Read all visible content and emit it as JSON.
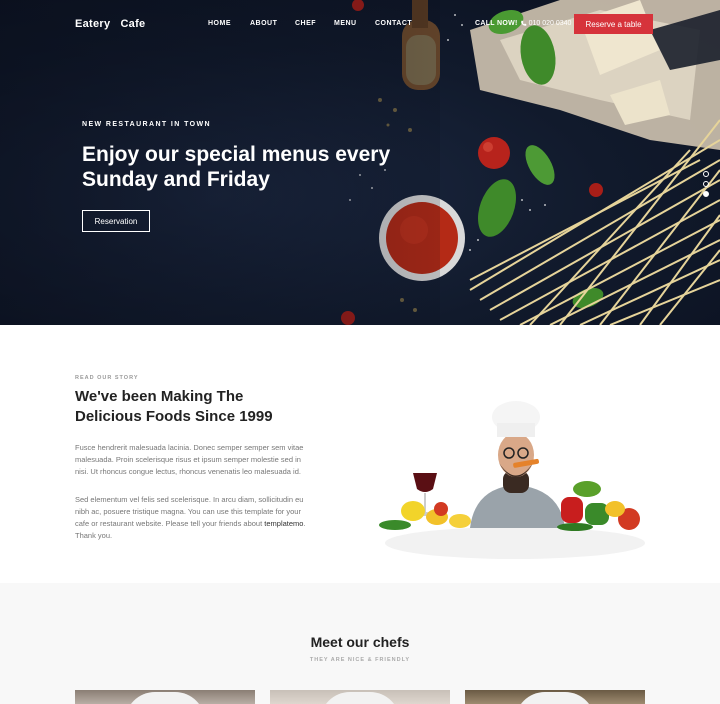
{
  "brand": {
    "word1": "Eatery",
    "word2": "Cafe"
  },
  "nav": {
    "items": [
      "HOME",
      "ABOUT",
      "CHEF",
      "MENU",
      "CONTACT"
    ],
    "call_label": "CALL NOW!",
    "phone": "010 020 0340",
    "reserve_button": "Reserve a table"
  },
  "hero": {
    "eyebrow": "NEW RESTAURANT IN TOWN",
    "title_line1": "Enjoy our special menus every",
    "title_line2": "Sunday and Friday",
    "button": "Reservation",
    "active_slide": 3,
    "slide_count": 3
  },
  "story": {
    "eyebrow": "READ OUR STORY",
    "title_line1": "We've been Making The",
    "title_line2": "Delicious Foods Since 1999",
    "paragraph1": "Fusce hendrerit malesuada lacinia. Donec semper semper sem vitae malesuada. Proin scelerisque risus et ipsum semper molestie sed in nisi. Ut rhoncus congue lectus, rhoncus venenatis leo malesuada id.",
    "paragraph2_start": "Sed elementum vel felis sed scelerisque. In arcu diam, sollicitudin eu nibh ac, posuere tristique magna. You can use this template for your cafe or restaurant website. Please tell your friends about ",
    "paragraph2_link": "templatemo",
    "paragraph2_end": ". Thank you."
  },
  "chefs": {
    "title": "Meet our chefs",
    "subtitle": "THEY ARE NICE & FRIENDLY"
  },
  "colors": {
    "accent": "#d6333b",
    "hero_bg": "#111a2c",
    "section_alt": "#f8f8f8"
  }
}
